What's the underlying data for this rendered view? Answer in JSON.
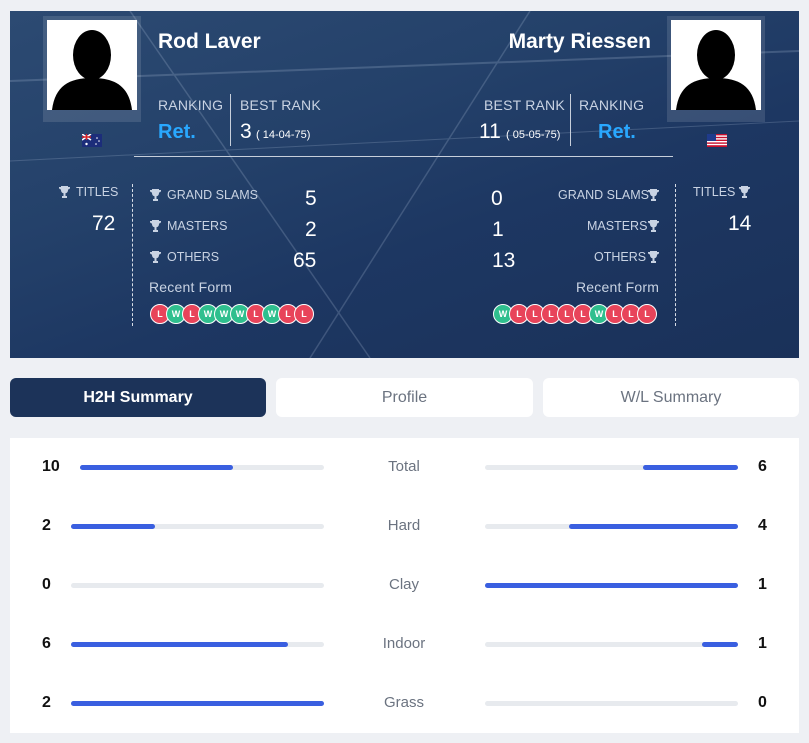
{
  "colors": {
    "hero_bg": "#1d3762",
    "accent_ret": "#29a8ff",
    "bar_fill": "#3a5fe0",
    "bar_track": "#e7eaee",
    "win": "#2fbf8e",
    "loss": "#e8445a",
    "tab_active": "#1c3359"
  },
  "player1": {
    "name": "Rod Laver",
    "flag": "australia-flag",
    "ranking_label": "RANKING",
    "ranking": "Ret.",
    "best_rank_label": "BEST RANK",
    "best_rank": "3",
    "best_rank_date": "( 14-04-75)",
    "titles_label": "TITLES",
    "titles": "72",
    "grand_slams_label": "GRAND SLAMS",
    "grand_slams": "5",
    "masters_label": "MASTERS",
    "masters": "2",
    "others_label": "OTHERS",
    "others": "65",
    "recent_form_label": "Recent Form",
    "recent_form": [
      "L",
      "W",
      "L",
      "W",
      "W",
      "W",
      "L",
      "W",
      "L",
      "L"
    ]
  },
  "player2": {
    "name": "Marty Riessen",
    "flag": "usa-flag",
    "ranking_label": "RANKING",
    "ranking": "Ret.",
    "best_rank_label": "BEST RANK",
    "best_rank": "11",
    "best_rank_date": "( 05-05-75)",
    "titles_label": "TITLES",
    "titles": "14",
    "grand_slams_label": "GRAND SLAMS",
    "grand_slams": "0",
    "masters_label": "MASTERS",
    "masters": "1",
    "others_label": "OTHERS",
    "others": "13",
    "recent_form_label": "Recent Form",
    "recent_form": [
      "W",
      "L",
      "L",
      "L",
      "L",
      "L",
      "W",
      "L",
      "L",
      "L"
    ]
  },
  "tabs": [
    {
      "label": "H2H Summary",
      "active": true
    },
    {
      "label": "Profile",
      "active": false
    },
    {
      "label": "W/L Summary",
      "active": false
    }
  ],
  "h2h": [
    {
      "category": "Total",
      "left": "10",
      "right": "6",
      "left_fraction": 0.625,
      "right_fraction": 0.375
    },
    {
      "category": "Hard",
      "left": "2",
      "right": "4",
      "left_fraction": 0.333,
      "right_fraction": 0.667
    },
    {
      "category": "Clay",
      "left": "0",
      "right": "1",
      "left_fraction": 0.0,
      "right_fraction": 1.0
    },
    {
      "category": "Indoor",
      "left": "6",
      "right": "1",
      "left_fraction": 0.857,
      "right_fraction": 0.143
    },
    {
      "category": "Grass",
      "left": "2",
      "right": "0",
      "left_fraction": 1.0,
      "right_fraction": 0.0
    }
  ]
}
